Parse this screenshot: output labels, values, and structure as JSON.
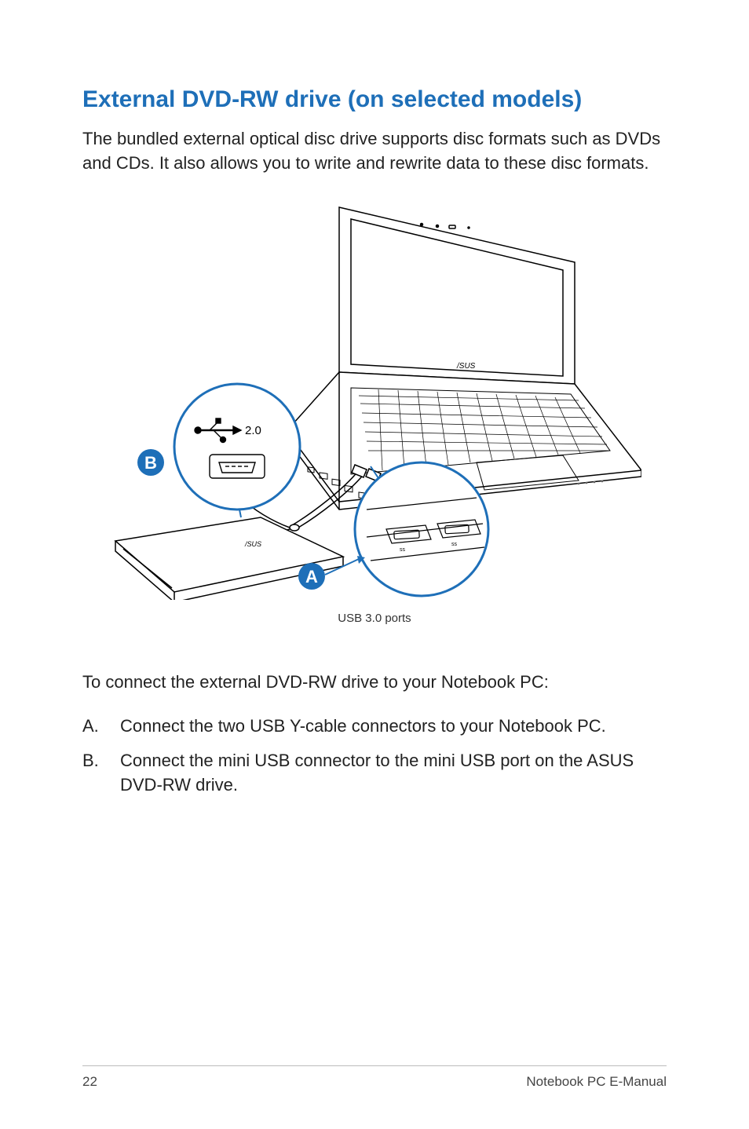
{
  "heading": "External DVD-RW drive (on selected models)",
  "intro": "The bundled external optical disc drive supports disc formats such as DVDs and CDs. It also allows you to write and rewrite data to these disc formats.",
  "diagram": {
    "caption": "USB 3.0 ports",
    "callout_a_letter": "A",
    "callout_b_letter": "B",
    "callout_b_label": "2.0"
  },
  "connect_title": "To connect the external DVD-RW drive to your Notebook PC:",
  "steps": [
    {
      "letter": "A.",
      "text": "Connect the two USB Y-cable connectors to your Notebook PC."
    },
    {
      "letter": "B.",
      "text": "Connect the  mini USB connector to the mini USB port on the ASUS DVD-RW drive."
    }
  ],
  "footer": {
    "page": "22",
    "title": "Notebook PC E-Manual"
  }
}
